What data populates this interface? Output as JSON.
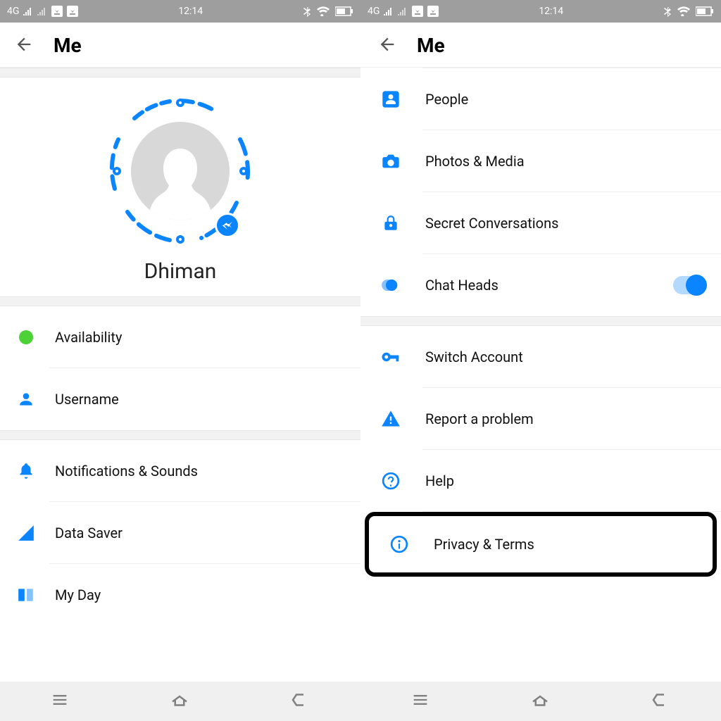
{
  "status": {
    "network": "4G",
    "time": "12:14"
  },
  "header": {
    "title": "Me"
  },
  "profile": {
    "name": "Dhiman"
  },
  "left": {
    "items": [
      {
        "label": "Availability"
      },
      {
        "label": "Username"
      },
      {
        "label": "Notifications & Sounds"
      },
      {
        "label": "Data Saver"
      },
      {
        "label": "My Day"
      }
    ]
  },
  "right": {
    "items": [
      {
        "label": "People"
      },
      {
        "label": "Photos & Media"
      },
      {
        "label": "Secret Conversations"
      },
      {
        "label": "Chat Heads",
        "toggle": true
      },
      {
        "label": "Switch Account"
      },
      {
        "label": "Report a problem"
      },
      {
        "label": "Help"
      },
      {
        "label": "Privacy & Terms"
      }
    ]
  }
}
